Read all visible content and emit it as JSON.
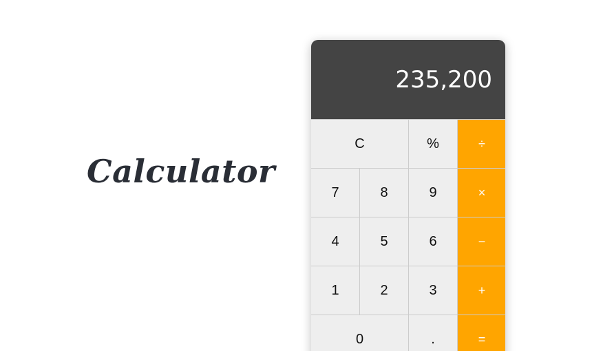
{
  "heading": {
    "title": "Calculator"
  },
  "calculator": {
    "display_value": "235,200",
    "keys": {
      "clear": "C",
      "percent": "%",
      "divide": "÷",
      "seven": "7",
      "eight": "8",
      "nine": "9",
      "multiply": "×",
      "four": "4",
      "five": "5",
      "six": "6",
      "subtract": "−",
      "one": "1",
      "two": "2",
      "three": "3",
      "add": "+",
      "zero": "0",
      "decimal": ".",
      "equals": "="
    }
  },
  "colors": {
    "display_bg": "#444444",
    "operator_bg": "#ffa500",
    "key_bg": "#eeeeee",
    "title_color": "#2a2e36"
  }
}
